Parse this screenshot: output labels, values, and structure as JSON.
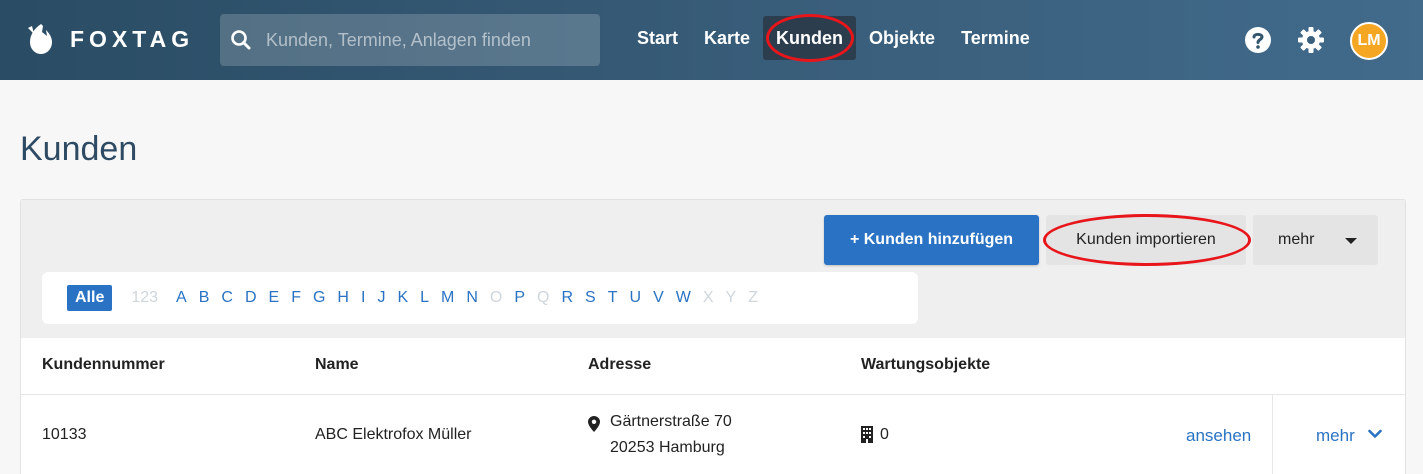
{
  "header": {
    "brand": "FOXTAG",
    "search_placeholder": "Kunden, Termine, Anlagen finden",
    "nav": [
      "Start",
      "Karte",
      "Kunden",
      "Objekte",
      "Termine"
    ],
    "active_nav": "Kunden",
    "avatar_initials": "LM",
    "icons": [
      "logo-fox-icon",
      "search-icon",
      "help-icon",
      "gear-icon"
    ]
  },
  "page": {
    "title": "Kunden"
  },
  "toolbar": {
    "add_label": "+ Kunden hinzufügen",
    "import_label": "Kunden importieren",
    "more_label": "mehr"
  },
  "alphabet": {
    "all_label": "Alle",
    "num_label": "123",
    "letters": [
      "A",
      "B",
      "C",
      "D",
      "E",
      "F",
      "G",
      "H",
      "I",
      "J",
      "K",
      "L",
      "M",
      "N",
      "O",
      "P",
      "Q",
      "R",
      "S",
      "T",
      "U",
      "V",
      "W",
      "X",
      "Y",
      "Z"
    ],
    "disabled": [
      "123",
      "O",
      "Q",
      "X",
      "Y",
      "Z"
    ]
  },
  "table": {
    "headers": [
      "Kundennummer",
      "Name",
      "Adresse",
      "Wartungsobjekte"
    ],
    "rows": [
      {
        "number": "10133",
        "name": "ABC Elektrofox Müller",
        "street": "Gärtnerstraße 70",
        "city": "20253 Hamburg",
        "objects": "0",
        "view_label": "ansehen",
        "more_label": "mehr"
      }
    ]
  },
  "colors": {
    "header_bg": "#345a76",
    "primary": "#2a73c4",
    "annotation": "#e8151b",
    "avatar": "#f5a623"
  }
}
